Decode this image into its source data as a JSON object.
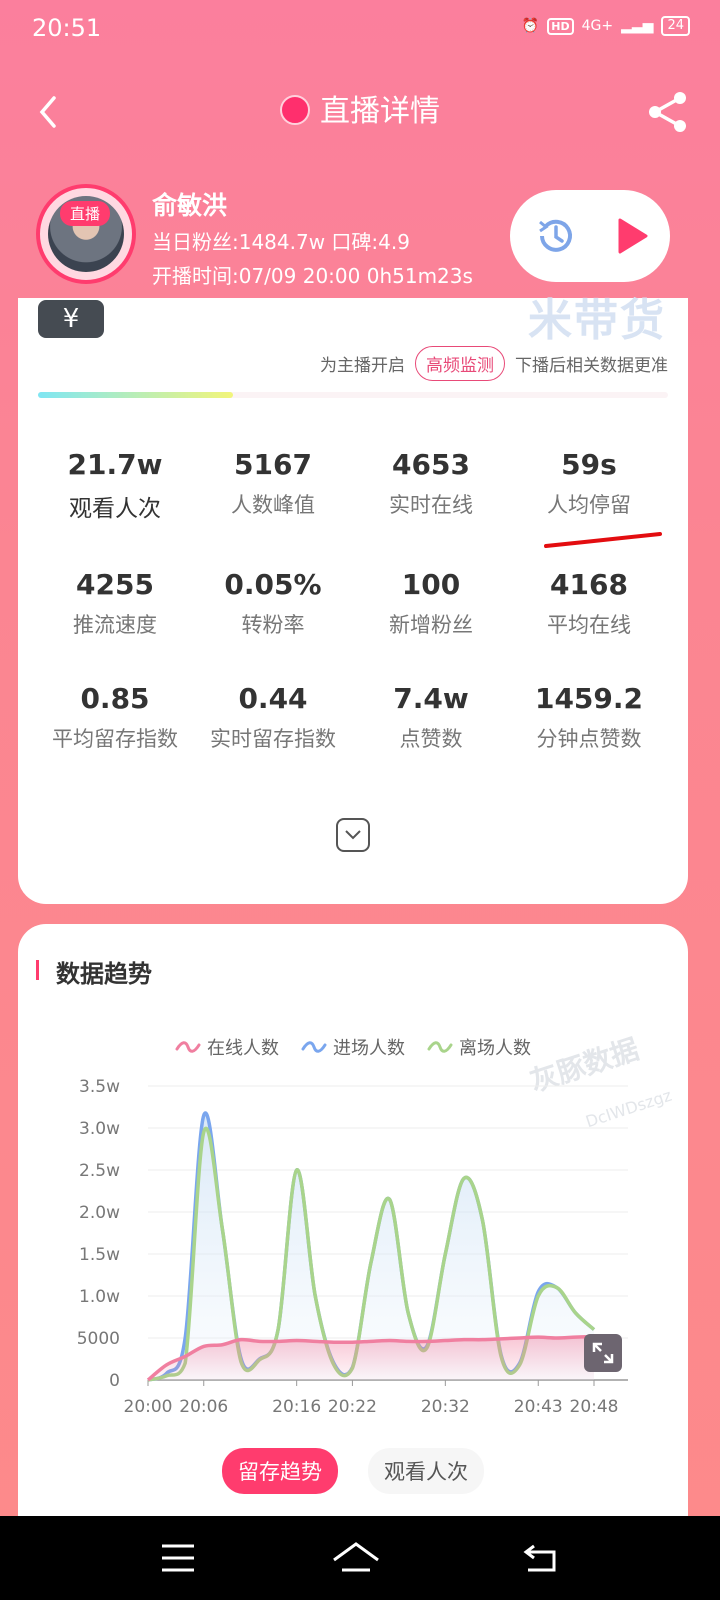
{
  "status": {
    "time": "20:51",
    "network": "4G+",
    "hd": "HD",
    "battery": "24"
  },
  "header": {
    "title": "直播详情"
  },
  "anchor": {
    "live_tag": "直播",
    "name": "俞敏洪",
    "fans_line": "当日粉丝:1484.7w   口碑:4.9",
    "start_line": "开播时间:07/09 20:00   0h51m23s"
  },
  "card": {
    "currency": "¥",
    "watermark": "米带货",
    "monitor_prefix": "为主播开启",
    "monitor_tag": "高频监测",
    "monitor_suffix": "下播后相关数据更准",
    "progress": 0.31,
    "stats": [
      {
        "value": "21.7w",
        "label": "观看人次"
      },
      {
        "value": "5167",
        "label": "人数峰值"
      },
      {
        "value": "4653",
        "label": "实时在线"
      },
      {
        "value": "59s",
        "label": "人均停留"
      },
      {
        "value": "4255",
        "label": "推流速度"
      },
      {
        "value": "0.05%",
        "label": "转粉率"
      },
      {
        "value": "100",
        "label": "新增粉丝"
      },
      {
        "value": "4168",
        "label": "平均在线"
      },
      {
        "value": "0.85",
        "label": "平均留存指数"
      },
      {
        "value": "0.44",
        "label": "实时留存指数"
      },
      {
        "value": "7.4w",
        "label": "点赞数"
      },
      {
        "value": "1459.2",
        "label": "分钟点赞数"
      }
    ]
  },
  "trend": {
    "title": "数据趋势",
    "watermark": "灰豚数据",
    "watermark_sub": "DcIWDszgz",
    "tabs": [
      "留存趋势",
      "观看人次"
    ]
  },
  "chart_data": {
    "type": "area",
    "x": [
      "20:00",
      "20:02",
      "20:04",
      "20:06",
      "20:08",
      "20:10",
      "20:12",
      "20:14",
      "20:16",
      "20:18",
      "20:20",
      "20:22",
      "20:24",
      "20:26",
      "20:28",
      "20:30",
      "20:32",
      "20:34",
      "20:36",
      "20:38",
      "20:40",
      "20:43",
      "20:45",
      "20:47",
      "20:48"
    ],
    "xticks": [
      "20:00",
      "20:06",
      "20:16",
      "20:22",
      "20:32",
      "20:43",
      "20:48"
    ],
    "yticks": [
      "0",
      "5000",
      "1.0w",
      "1.5w",
      "2.0w",
      "2.5w",
      "3.0w",
      "3.5w"
    ],
    "ylim": [
      0,
      35000
    ],
    "series": [
      {
        "name": "在线人数",
        "color": "#f07fa0",
        "values": [
          0,
          1800,
          2800,
          4000,
          4200,
          4800,
          4600,
          4600,
          4700,
          4600,
          4500,
          4500,
          4600,
          4700,
          4600,
          4600,
          4700,
          4800,
          4800,
          4900,
          5000,
          5100,
          5000,
          5100,
          5167
        ]
      },
      {
        "name": "进场人数",
        "color": "#7aa6ee",
        "values": [
          0,
          800,
          5000,
          31500,
          18000,
          2600,
          2500,
          6000,
          25000,
          10000,
          2000,
          1500,
          14000,
          21500,
          8000,
          4000,
          15000,
          24000,
          19000,
          3000,
          2000,
          10500,
          11000,
          8000,
          6000
        ]
      },
      {
        "name": "离场人数",
        "color": "#a9d48b",
        "values": [
          0,
          500,
          2000,
          29500,
          18000,
          2200,
          2400,
          6000,
          25000,
          10000,
          1800,
          1400,
          14000,
          21500,
          8000,
          3800,
          15000,
          24000,
          19000,
          2800,
          1800,
          10000,
          11000,
          8000,
          6000
        ]
      }
    ]
  }
}
